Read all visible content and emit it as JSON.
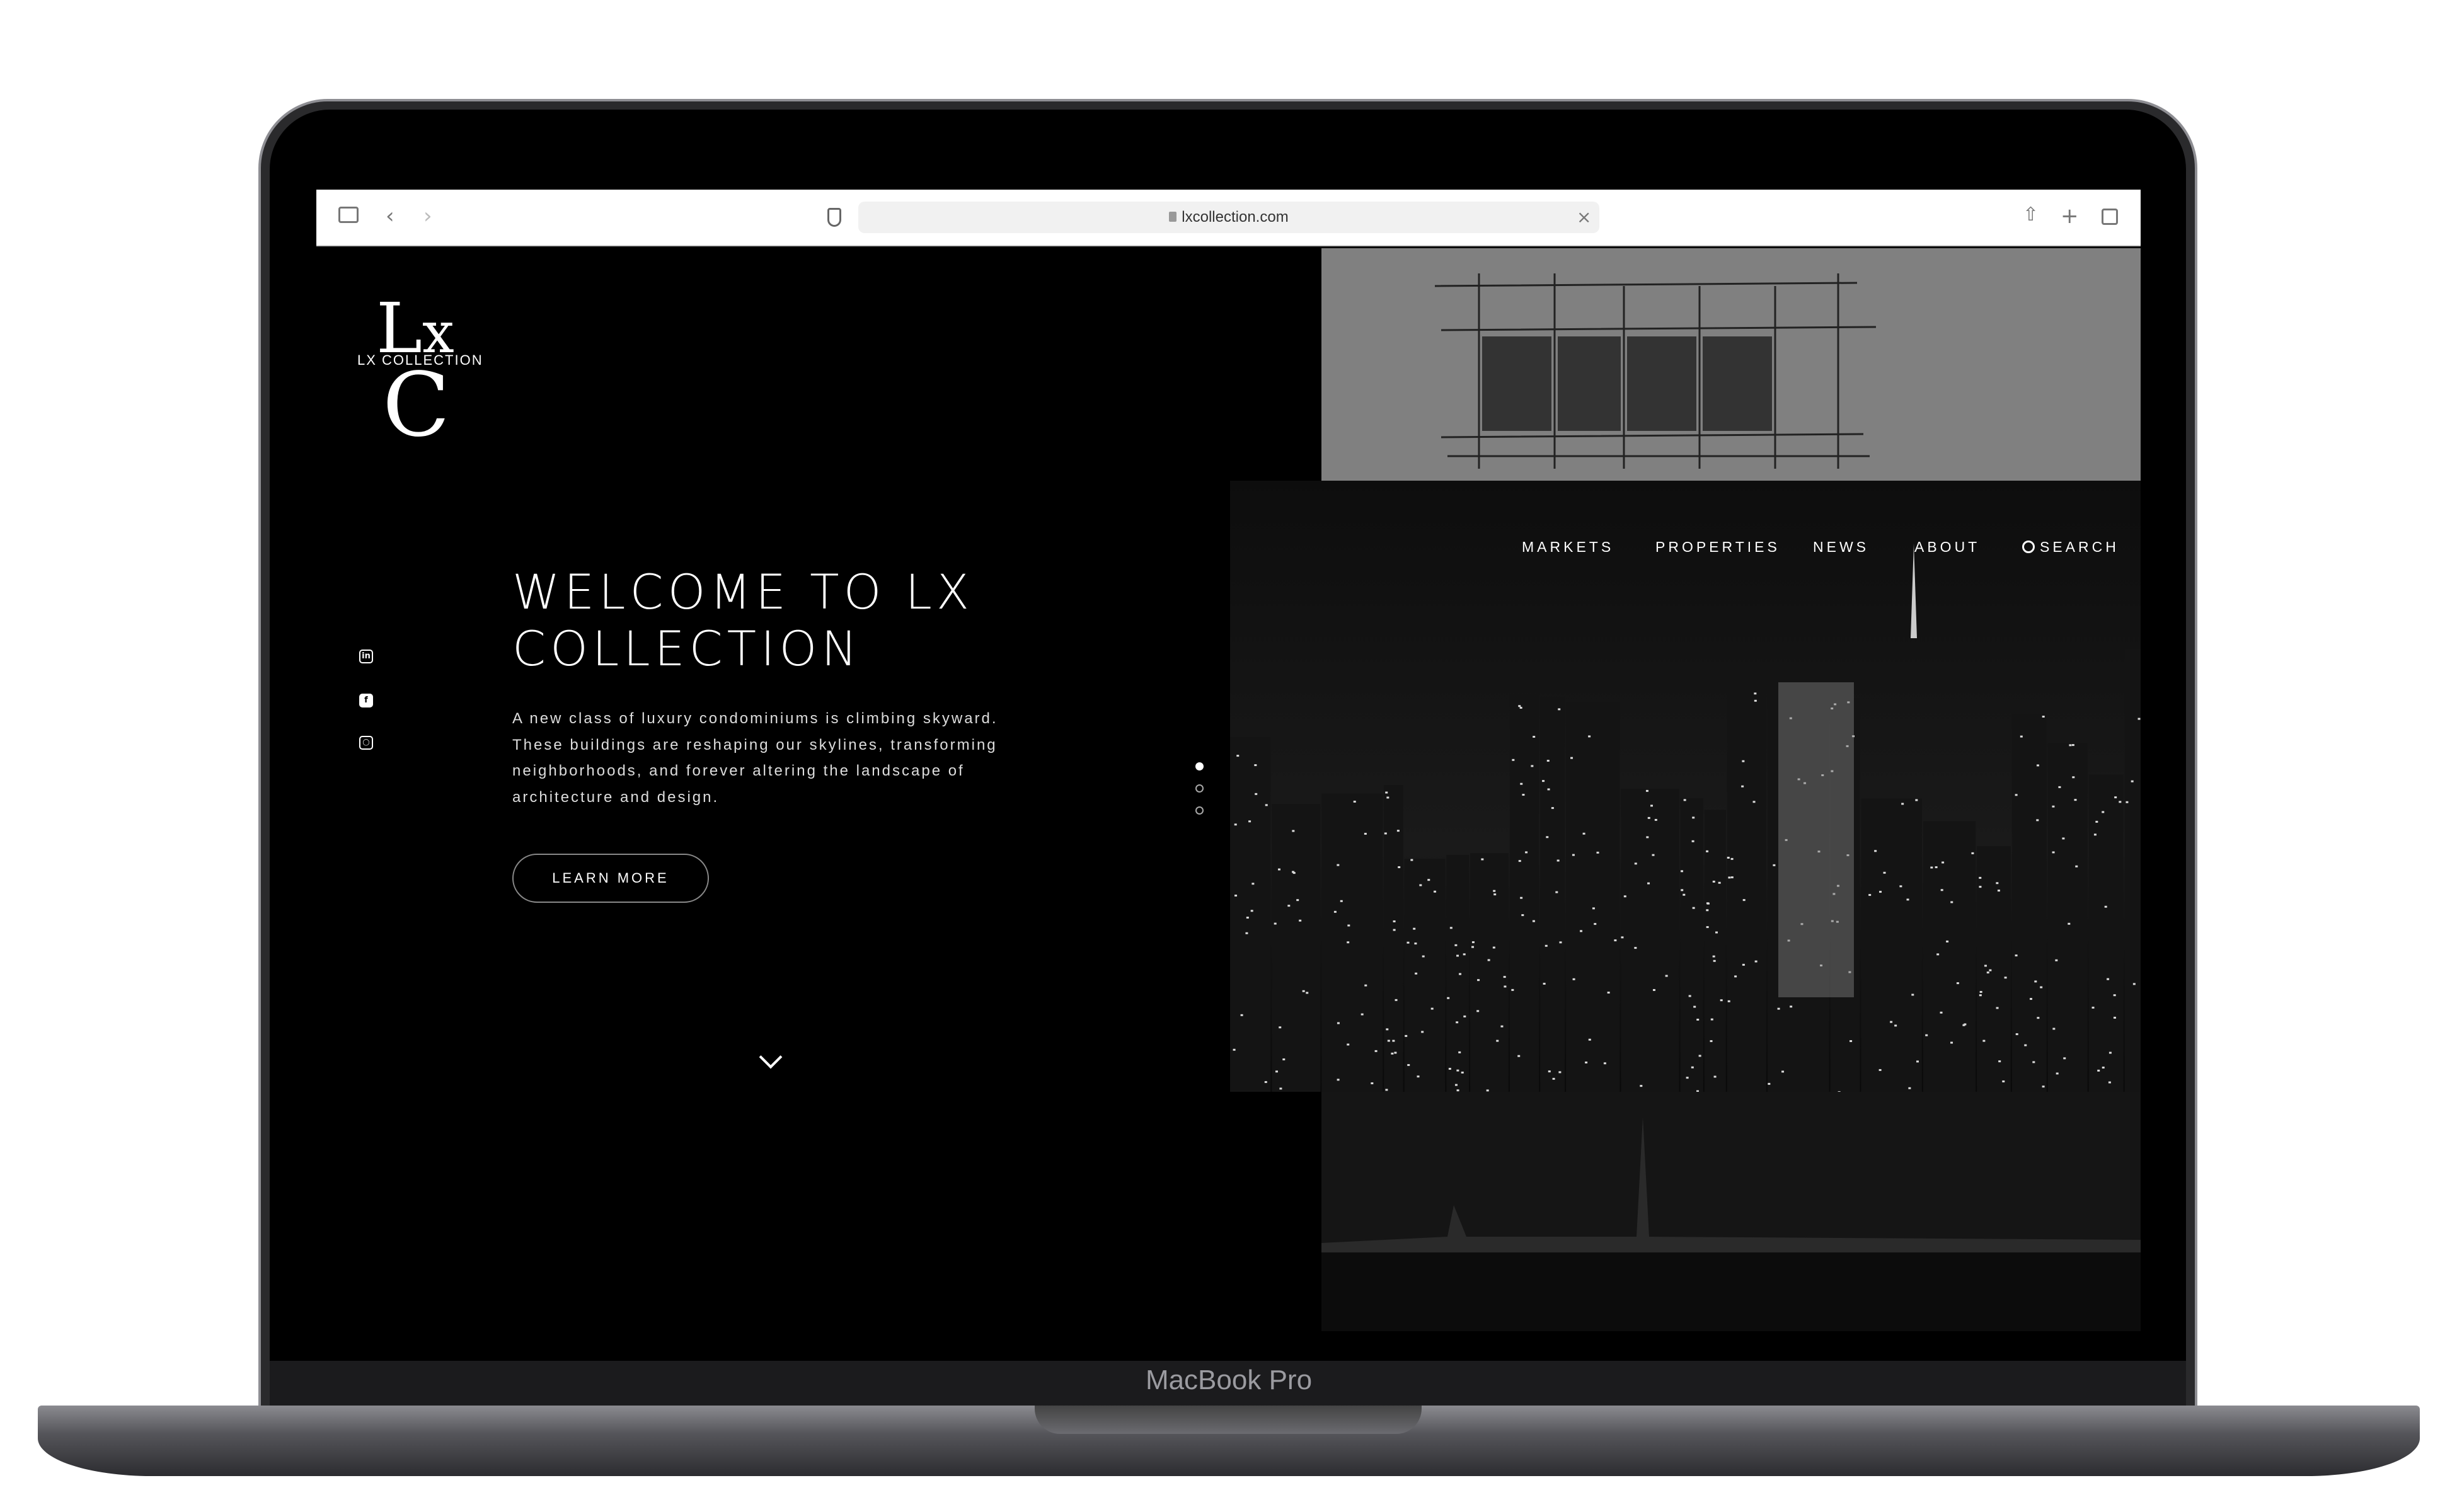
{
  "device": {
    "label": "MacBook Pro"
  },
  "browser": {
    "url": "lxcollection.com",
    "icons": [
      "sidebar-icon",
      "back-icon",
      "forward-icon",
      "shield-icon",
      "lock-icon",
      "clear-icon",
      "share-icon",
      "new-tab-icon",
      "tabs-icon"
    ]
  },
  "site": {
    "logo": {
      "letters": "LXC",
      "text": "LX COLLECTION"
    },
    "nav": [
      {
        "label": "MARKETS"
      },
      {
        "label": "PROPERTIES"
      },
      {
        "label": "NEWS"
      },
      {
        "label": "ABOUT"
      },
      {
        "label": "SEARCH"
      }
    ],
    "hero": {
      "title": "WELCOME TO LX COLLECTION",
      "body": "A new class of luxury condominiums is climbing skyward. These buildings are reshaping our skylines, transforming neighborhoods, and forever altering the landscape of architecture and design.",
      "cta": "LEARN MORE"
    },
    "social": [
      "linkedin-icon",
      "facebook-icon",
      "instagram-icon"
    ],
    "slider": {
      "count": 3,
      "active": 1
    },
    "colors": {
      "background": "#000000",
      "text": "#ffffff",
      "sketch_panel": "#808080"
    }
  }
}
